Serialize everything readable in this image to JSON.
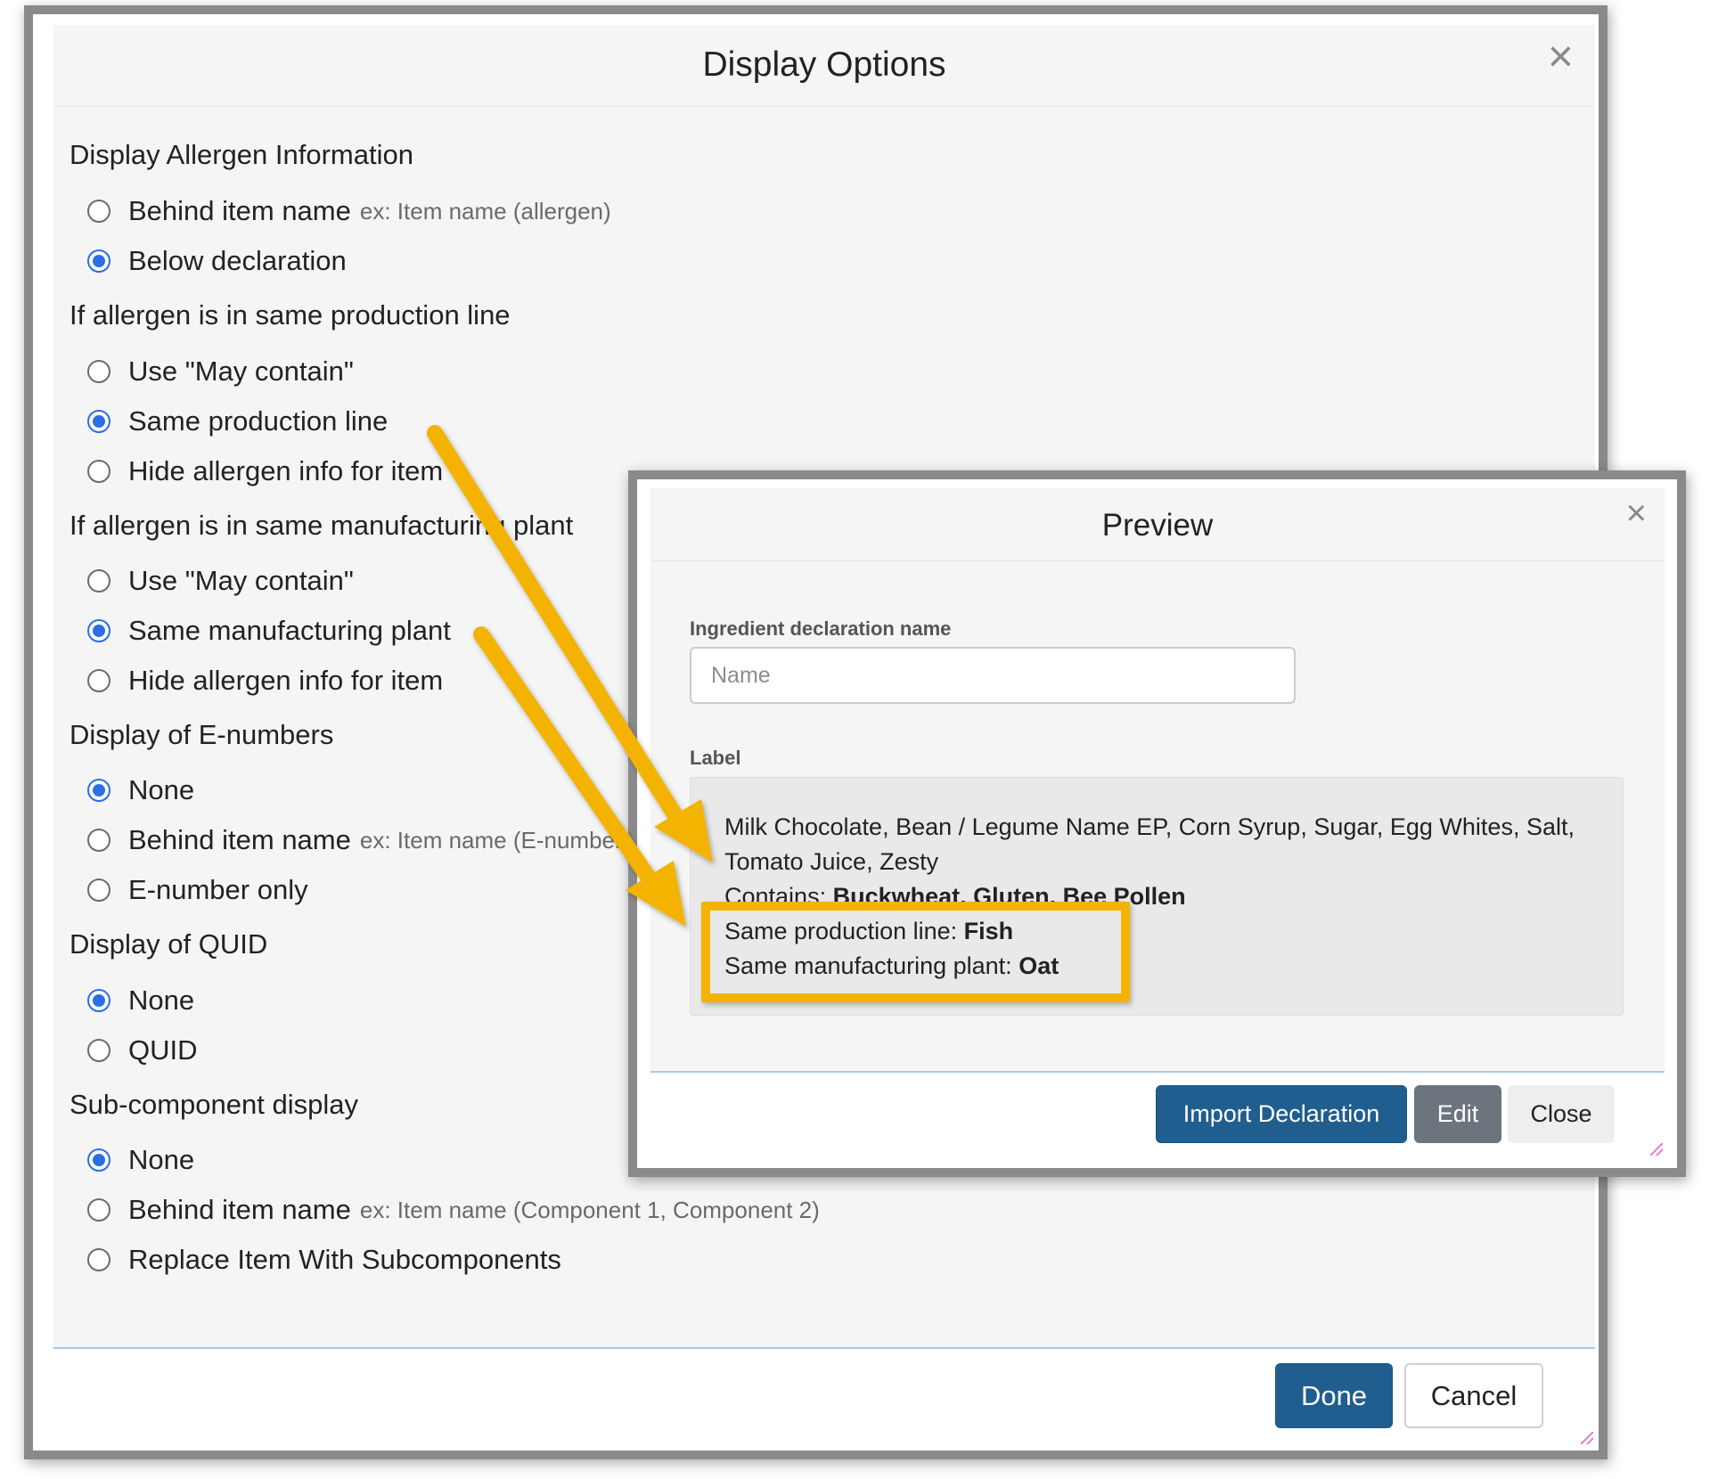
{
  "display_options": {
    "title": "Display Options",
    "close_icon": "close-icon",
    "sections": [
      {
        "heading": "Display Allergen Information",
        "options": [
          {
            "label": "Behind item name",
            "example": "ex: Item name (allergen)",
            "checked": false
          },
          {
            "label": "Below declaration",
            "example": "",
            "checked": true
          }
        ]
      },
      {
        "heading": "If allergen is in same production line",
        "options": [
          {
            "label": "Use \"May contain\"",
            "example": "",
            "checked": false
          },
          {
            "label": "Same production line",
            "example": "",
            "checked": true
          },
          {
            "label": "Hide allergen info for item",
            "example": "",
            "checked": false
          }
        ]
      },
      {
        "heading": "If allergen is in same manufacturing plant",
        "options": [
          {
            "label": "Use \"May contain\"",
            "example": "",
            "checked": false
          },
          {
            "label": "Same manufacturing plant",
            "example": "",
            "checked": true
          },
          {
            "label": "Hide allergen info for item",
            "example": "",
            "checked": false
          }
        ]
      },
      {
        "heading": "Display of E-numbers",
        "options": [
          {
            "label": "None",
            "example": "",
            "checked": true
          },
          {
            "label": "Behind item name",
            "example": "ex: Item name (E-number)",
            "checked": false
          },
          {
            "label": "E-number only",
            "example": "",
            "checked": false
          }
        ]
      },
      {
        "heading": "Display of QUID",
        "options": [
          {
            "label": "None",
            "example": "",
            "checked": true
          },
          {
            "label": "QUID",
            "example": "",
            "checked": false
          }
        ]
      },
      {
        "heading": "Sub-component display",
        "options": [
          {
            "label": "None",
            "example": "",
            "checked": true
          },
          {
            "label": "Behind item name",
            "example": "ex: Item name (Component 1, Component 2)",
            "checked": false
          },
          {
            "label": "Replace Item With Subcomponents",
            "example": "",
            "checked": false
          }
        ]
      }
    ],
    "footer": {
      "done_label": "Done",
      "cancel_label": "Cancel"
    }
  },
  "preview": {
    "title": "Preview",
    "close_icon": "close-icon",
    "ingredient_declaration_label": "Ingredient declaration name",
    "name_placeholder": "Name",
    "label_heading": "Label",
    "label_line1": "Milk Chocolate, Bean / Legume Name EP, Corn Syrup, Sugar, Egg Whites, Salt,",
    "label_line2": "Tomato Juice, Zesty",
    "contains_prefix": "Contains: ",
    "contains_value": "Buckwheat, Gluten, Bee Pollen",
    "production_line_prefix": "Same production line: ",
    "production_line_value": "Fish",
    "manufacturing_plant_prefix": "Same manufacturing plant: ",
    "manufacturing_plant_value": "Oat",
    "footer": {
      "import_label": "Import Declaration",
      "edit_label": "Edit",
      "close_label": "Close"
    }
  },
  "colors": {
    "primary": "#1f5e8e",
    "radio_checked": "#2b6ee8",
    "annotation": "#f3b300",
    "secondary": "#6c757d"
  }
}
